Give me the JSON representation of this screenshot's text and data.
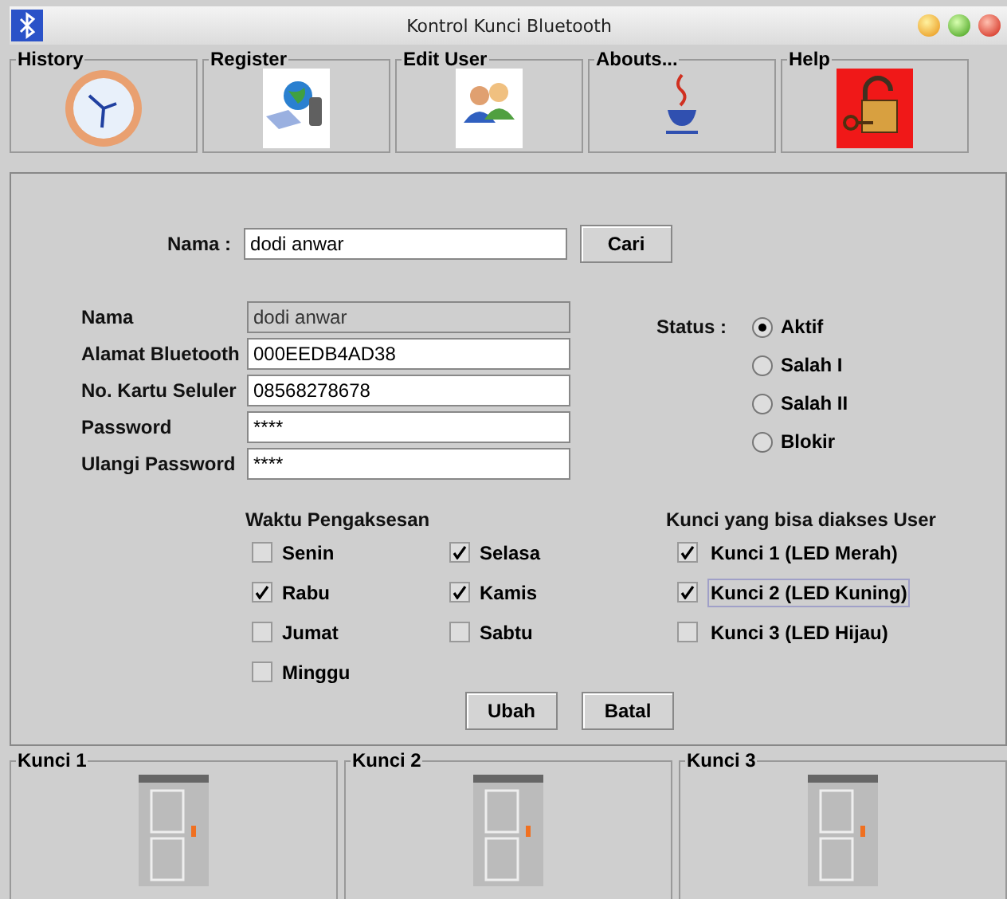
{
  "window": {
    "title": "Kontrol Kunci Bluetooth"
  },
  "toolbar": [
    {
      "label": "History",
      "kind": "clock"
    },
    {
      "label": "Register",
      "kind": "network"
    },
    {
      "label": "Edit User",
      "kind": "users"
    },
    {
      "label": "Abouts...",
      "kind": "cup"
    },
    {
      "label": "Help",
      "kind": "padlock"
    }
  ],
  "search": {
    "label": "Nama :",
    "value": "dodi anwar",
    "button": "Cari"
  },
  "fields": [
    {
      "label": "Nama",
      "value": "dodi anwar",
      "disabled": true
    },
    {
      "label": "Alamat Bluetooth",
      "value": "000EEDB4AD38",
      "disabled": false
    },
    {
      "label": "No. Kartu Seluler",
      "value": "08568278678",
      "disabled": false
    },
    {
      "label": "Password",
      "value": "****",
      "disabled": false
    },
    {
      "label": "Ulangi Password",
      "value": "****",
      "disabled": false
    }
  ],
  "status": {
    "label": "Status :",
    "options": [
      {
        "label": "Aktif",
        "selected": true
      },
      {
        "label": "Salah I",
        "selected": false
      },
      {
        "label": "Salah II",
        "selected": false
      },
      {
        "label": "Blokir",
        "selected": false
      }
    ]
  },
  "access_time": {
    "title": "Waktu Pengaksesan",
    "days": [
      {
        "label": "Senin",
        "checked": false
      },
      {
        "label": "Selasa",
        "checked": true
      },
      {
        "label": "Rabu",
        "checked": true
      },
      {
        "label": "Kamis",
        "checked": true
      },
      {
        "label": "Jumat",
        "checked": false
      },
      {
        "label": "Sabtu",
        "checked": false
      },
      {
        "label": "Minggu",
        "checked": false
      }
    ]
  },
  "locks": {
    "title": "Kunci yang bisa diakses User",
    "items": [
      {
        "label": "Kunci 1 (LED Merah)",
        "checked": true,
        "focused": false
      },
      {
        "label": "Kunci 2 (LED Kuning)",
        "checked": true,
        "focused": true
      },
      {
        "label": "Kunci 3  (LED Hijau)",
        "checked": false,
        "focused": false
      }
    ]
  },
  "buttons": [
    "Ubah",
    "Batal"
  ],
  "lock_panels": [
    {
      "title": "Kunci 1"
    },
    {
      "title": "Kunci 2"
    },
    {
      "title": "Kunci 3"
    }
  ]
}
